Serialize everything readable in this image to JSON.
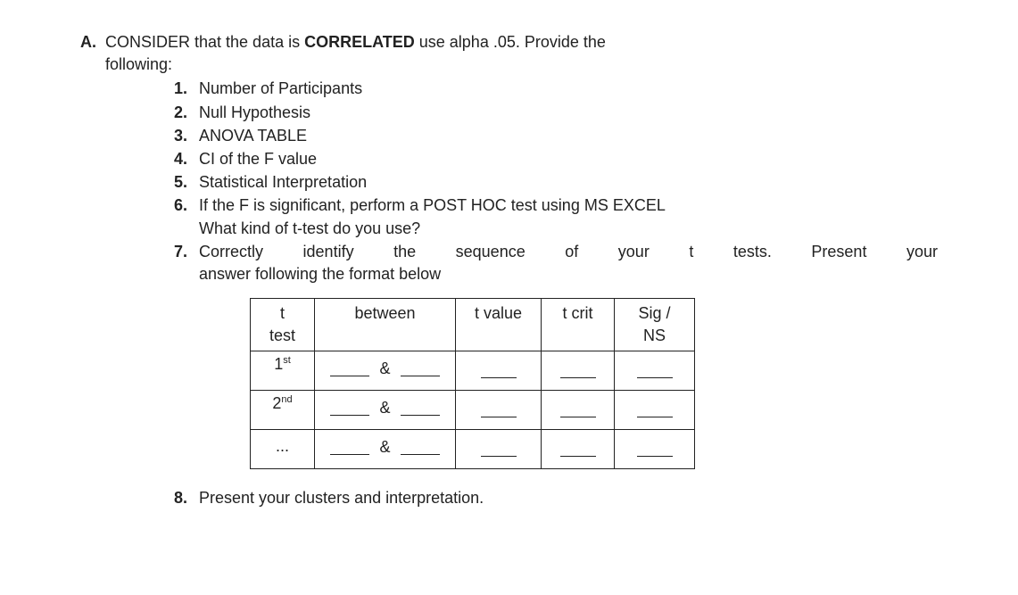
{
  "section": {
    "label": "A.",
    "line1_pre": "CONSIDER that the data is ",
    "line1_bold": "CORRELATED",
    "line1_post": " use alpha .05. Provide the",
    "line2": "following:"
  },
  "items": {
    "i1": {
      "num": "1.",
      "text": "Number of Participants"
    },
    "i2": {
      "num": "2.",
      "text": "Null Hypothesis"
    },
    "i3": {
      "num": "3.",
      "text": "ANOVA TABLE"
    },
    "i4": {
      "num": "4.",
      "text": "CI of the F value"
    },
    "i5": {
      "num": "5.",
      "text": "Statistical Interpretation"
    },
    "i6": {
      "num": "6.",
      "line1": "If the F is significant, perform a POST HOC test using MS EXCEL",
      "line2": "What kind of t-test do you use?"
    },
    "i7": {
      "num": "7.",
      "line1": "Correctly identify the sequence of your t tests.  Present your",
      "line2": "answer following the format below"
    },
    "i8": {
      "num": "8.",
      "text": "Present your clusters and interpretation."
    }
  },
  "table": {
    "headers": {
      "h1a": "t",
      "h1b": "test",
      "h2": "between",
      "h3": "t value",
      "h4": "t crit",
      "h5a": "Sig /",
      "h5b": "NS"
    },
    "rows": {
      "r1": {
        "label_pre": "1",
        "label_sup": "st",
        "amp": "&"
      },
      "r2": {
        "label_pre": "2",
        "label_sup": "nd",
        "amp": "&"
      },
      "r3": {
        "label": "...",
        "amp": "&"
      }
    }
  }
}
